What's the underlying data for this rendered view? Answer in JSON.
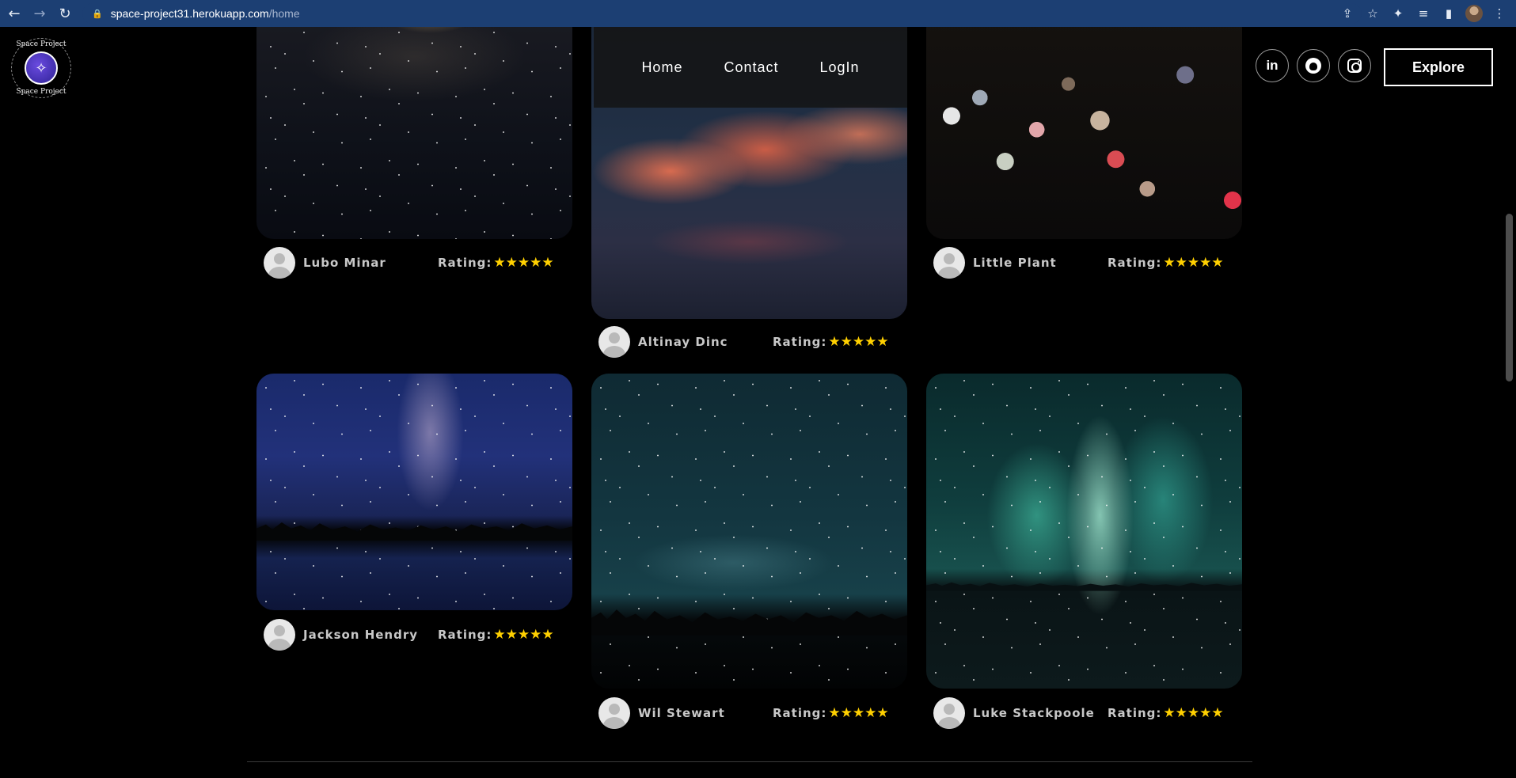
{
  "browser": {
    "url_host": "space-project31.herokuapp.com",
    "url_path": "/home"
  },
  "header": {
    "logo_text": "Space Project",
    "nav": [
      "Home",
      "Contact",
      "LogIn"
    ],
    "socials": [
      "linkedin-icon",
      "github-icon",
      "instagram-icon"
    ],
    "social_labels": {
      "linkedin": "in"
    },
    "explore_label": "Explore"
  },
  "cards": [
    {
      "author": "Lubo Minar",
      "rating_label": "Rating:",
      "stars": 5,
      "stars_text": "★★★★★"
    },
    {
      "author": "Altinay Dinc",
      "rating_label": "Rating:",
      "stars": 5,
      "stars_text": "★★★★★"
    },
    {
      "author": "Little Plant",
      "rating_label": "Rating:",
      "stars": 5,
      "stars_text": "★★★★★"
    },
    {
      "author": "Jackson Hendry",
      "rating_label": "Rating:",
      "stars": 5,
      "stars_text": "★★★★★"
    },
    {
      "author": "Wil Stewart",
      "rating_label": "Rating:",
      "stars": 5,
      "stars_text": "★★★★★"
    },
    {
      "author": "Luke Stackpoole",
      "rating_label": "Rating:",
      "stars": 5,
      "stars_text": "★★★★★"
    }
  ],
  "colors": {
    "background": "#000000",
    "star": "#ffd000",
    "browser_bar": "#1c3f73"
  }
}
